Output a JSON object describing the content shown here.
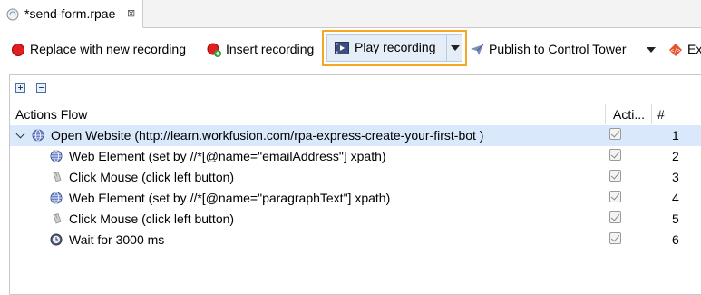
{
  "editor_tab": {
    "title": "*send-form.rpae",
    "close_glyph": "⊠"
  },
  "toolbar": {
    "replace": "Replace with new recording",
    "insert": "Insert recording",
    "play": "Play recording",
    "publish": "Publish to Control Tower",
    "export": "Exp"
  },
  "table": {
    "headers": {
      "flow": "Actions Flow",
      "active": "Acti...",
      "num": "#"
    },
    "rows": [
      {
        "label": "Open Website (http://learn.workfusion.com/rpa-express-create-your-first-bot )",
        "icon": "globe-icon",
        "checked": true,
        "num": "1",
        "depth": 0,
        "selected": true
      },
      {
        "label": "Web Element (set by //*[@name=\"emailAddress\"] xpath)",
        "icon": "globe-icon",
        "checked": true,
        "num": "2",
        "depth": 1
      },
      {
        "label": "Click Mouse (click left button)",
        "icon": "mouse-icon",
        "checked": true,
        "num": "3",
        "depth": 1
      },
      {
        "label": "Web Element (set by //*[@name=\"paragraphText\"] xpath)",
        "icon": "globe-icon",
        "checked": true,
        "num": "4",
        "depth": 1
      },
      {
        "label": "Click Mouse (click left button)",
        "icon": "mouse-icon",
        "checked": true,
        "num": "5",
        "depth": 1
      },
      {
        "label": "Wait for 3000 ms",
        "icon": "clock-icon",
        "checked": true,
        "num": "6",
        "depth": 1
      }
    ]
  },
  "colors": {
    "highlight_border": "#f5a623",
    "selected_row": "#d9e8fb",
    "record_red": "#e02020"
  }
}
